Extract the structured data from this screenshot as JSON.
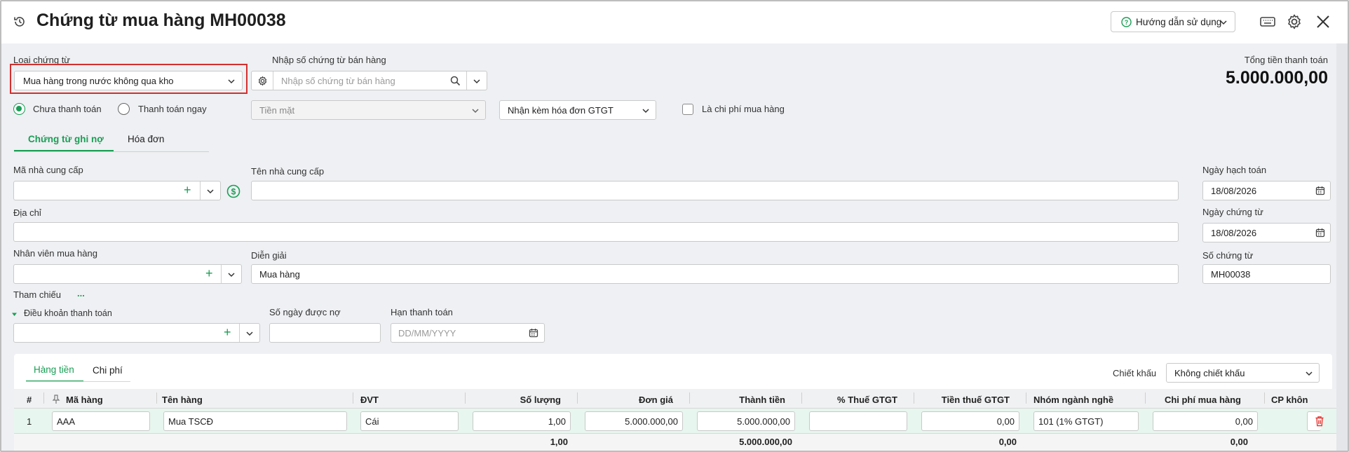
{
  "header": {
    "title": "Chứng từ mua hàng MH00038",
    "help_label": "Hướng dẫn sử dụng"
  },
  "top": {
    "voucher_type_label": "Loại chứng từ",
    "voucher_type_value": "Mua hàng trong nước không qua kho",
    "sales_voucher_label": "Nhập số chứng từ bán hàng",
    "sales_voucher_placeholder": "Nhập số chứng từ bán hàng",
    "total_label": "Tổng tiền thanh toán",
    "total_value": "5.000.000,00",
    "radio_unpaid": "Chưa thanh toán",
    "radio_paid": "Thanh toán ngay",
    "payment_method": "Tiền mặt",
    "invoice_option": "Nhận kèm hóa đơn GTGT",
    "purchase_cost_label": "Là chi phí mua hàng"
  },
  "tabs": {
    "debit_voucher": "Chứng từ ghi nợ",
    "invoice": "Hóa đơn"
  },
  "form": {
    "supplier_code_label": "Mã nhà cung cấp",
    "supplier_name_label": "Tên nhà cung cấp",
    "address_label": "Địa chỉ",
    "buyer_label": "Nhân viên mua hàng",
    "description_label": "Diễn giải",
    "description_value": "Mua hàng",
    "reference_label": "Tham chiếu",
    "reference_more": "...",
    "payment_terms_label": "Điều khoản thanh toán",
    "credit_days_label": "Số ngày được nợ",
    "due_date_label": "Hạn thanh toán",
    "due_date_placeholder": "DD/MM/YYYY",
    "posting_date_label": "Ngày hạch toán",
    "posting_date_value": "18/08/2026",
    "voucher_date_label": "Ngày chứng từ",
    "voucher_date_value": "18/08/2026",
    "voucher_no_label": "Số chứng từ",
    "voucher_no_value": "MH00038"
  },
  "detail": {
    "tab_goods": "Hàng tiền",
    "tab_costs": "Chi phí",
    "discount_label": "Chiết khấu",
    "discount_value": "Không chiết khấu",
    "columns": [
      "#",
      "Mã hàng",
      "Tên hàng",
      "ĐVT",
      "Số lượng",
      "Đơn giá",
      "Thành tiền",
      "% Thuế GTGT",
      "Tiền thuế GTGT",
      "Nhóm ngành nghề",
      "Chi phí mua hàng",
      "CP khôn"
    ],
    "row": {
      "index": "1",
      "item_code": "AAA",
      "item_name": "Mua TSCĐ",
      "unit": "Cái",
      "quantity": "1,00",
      "unit_price": "5.000.000,00",
      "amount": "5.000.000,00",
      "vat_rate": "",
      "vat_amount": "0,00",
      "industry_group": "101 (1% GTGT)",
      "purchase_cost": "0,00"
    },
    "totals": {
      "quantity": "1,00",
      "amount": "5.000.000,00",
      "vat_amount": "0,00",
      "purchase_cost": "0,00"
    }
  },
  "colors": {
    "accent": "#1a9e55",
    "highlight_border": "#d32f2f",
    "delete": "#e53935"
  }
}
